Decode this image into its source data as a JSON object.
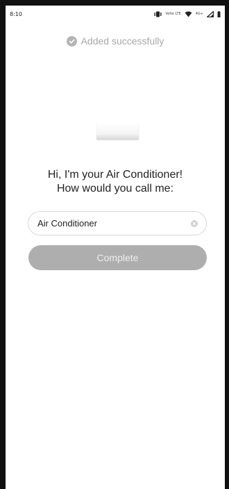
{
  "status_bar": {
    "time": "8:10",
    "network_label": "Volte LTE",
    "signal_label": "4G+",
    "icons": [
      "vibrate-icon",
      "volte-icon",
      "wifi-icon",
      "cell-signal-icon",
      "battery-icon"
    ]
  },
  "success": {
    "message": "Added successfully",
    "icon": "check-circle-icon"
  },
  "device": {
    "image_label": "air-conditioner-image"
  },
  "prompt": {
    "line1": "Hi, I'm your Air Conditioner!",
    "line2": "How would you call me:"
  },
  "name_input": {
    "value": "Air Conditioner",
    "clear_icon": "clear-icon"
  },
  "complete_button": {
    "label": "Complete",
    "enabled": false
  },
  "colors": {
    "muted_text": "#a8a8a8",
    "button_disabled": "#aeaeae",
    "field_border": "#d8d8d8"
  }
}
